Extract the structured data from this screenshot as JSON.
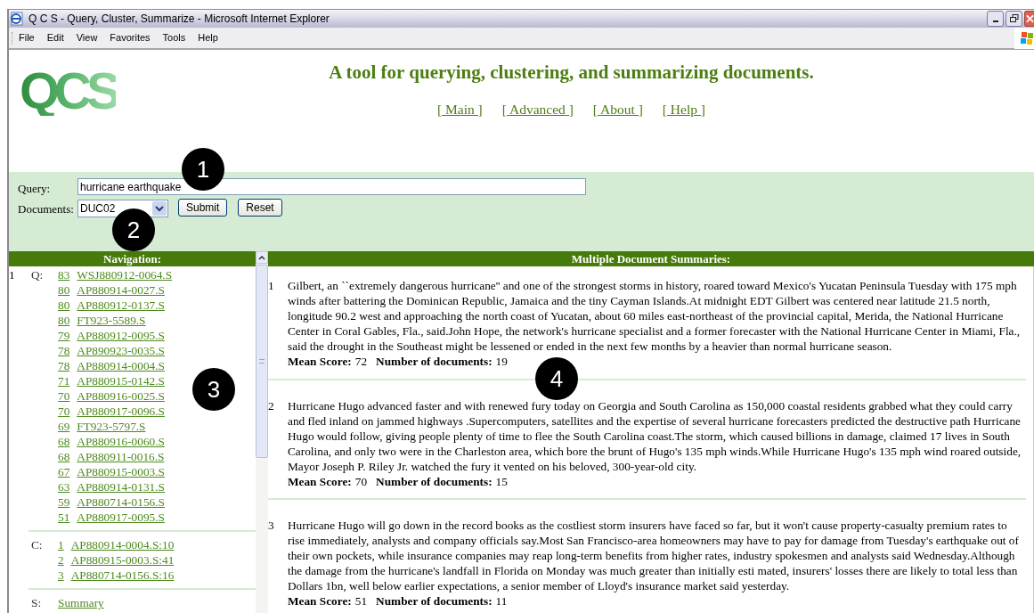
{
  "window": {
    "title": "Q C S - Query, Cluster, Summarize - Microsoft Internet Explorer"
  },
  "menu": [
    {
      "label": "File"
    },
    {
      "label": "Edit"
    },
    {
      "label": "View"
    },
    {
      "label": "Favorites"
    },
    {
      "label": "Tools"
    },
    {
      "label": "Help"
    }
  ],
  "header": {
    "logo": "QCS",
    "heading": "A tool for querying, clustering, and summarizing documents.",
    "nav_links": [
      "[ Main ]",
      "[ Advanced ]",
      "[ About ]",
      "[ Help ]"
    ]
  },
  "form": {
    "query_label": "Query:",
    "query_value": "hurricane earthquake",
    "documents_label": "Documents:",
    "documents_value": "DUC02",
    "buttons": [
      "Submit",
      "Reset"
    ]
  },
  "navigation": {
    "title": "Navigation:",
    "number": "1",
    "groups": [
      {
        "label": "Q:",
        "links": [
          {
            "score": "83",
            "doc": "WSJ880912-0064.S"
          },
          {
            "score": "80",
            "doc": "AP880914-0027.S"
          },
          {
            "score": "80",
            "doc": "AP880912-0137.S"
          },
          {
            "score": "80",
            "doc": "FT923-5589.S"
          },
          {
            "score": "79",
            "doc": "AP880912-0095.S"
          },
          {
            "score": "78",
            "doc": "AP890923-0035.S"
          },
          {
            "score": "78",
            "doc": "AP880914-0004.S"
          },
          {
            "score": "71",
            "doc": "AP880915-0142.S"
          },
          {
            "score": "70",
            "doc": "AP880916-0025.S"
          },
          {
            "score": "70",
            "doc": "AP880917-0096.S"
          },
          {
            "score": "69",
            "doc": "FT923-5797.S"
          },
          {
            "score": "68",
            "doc": "AP880916-0060.S"
          },
          {
            "score": "68",
            "doc": "AP880911-0016.S"
          },
          {
            "score": "67",
            "doc": "AP880915-0003.S"
          },
          {
            "score": "63",
            "doc": "AP880914-0131.S"
          },
          {
            "score": "59",
            "doc": "AP880714-0156.S"
          },
          {
            "score": "51",
            "doc": "AP880917-0095.S"
          }
        ]
      },
      {
        "label": "C:",
        "links": [
          {
            "score": "1",
            "doc": "AP880914-0004.S:10"
          },
          {
            "score": "2",
            "doc": "AP880915-0003.S:41"
          },
          {
            "score": "3",
            "doc": "AP880714-0156.S:16"
          }
        ]
      },
      {
        "label": "S:",
        "links": [
          {
            "doc": "Summary"
          }
        ]
      }
    ]
  },
  "summaries": {
    "title": "Multiple Document Summaries:",
    "items": [
      {
        "number": "1",
        "text": "Gilbert, an ``extremely dangerous hurricane'' and one of the strongest storms in history, roared toward Mexico's Yucatan Peninsula Tuesday with 175 mph winds after battering the Dominican Republic, Jamaica and the tiny Cayman Islands.At midnight EDT Gilbert was centered near latitude 21.5 north, longitude 90.2 west and approaching the north coast of Yucatan, about 60 miles east-northeast of the provincial capital, Merida, the National Hurricane Center in Coral Gables, Fla., said.John Hope, the network's hurricane specialist and a former forecaster with the National Hurricane Center in Miami, Fla., said the drought in the Southeast might be lessened or ended in the next few months by a heavier than normal hurricane season.",
        "score_label": "Mean Score:",
        "score": "72",
        "count_label": "Number of documents:",
        "count": "19"
      },
      {
        "number": "2",
        "text": "Hurricane Hugo advanced faster and with renewed fury today on Georgia and South Carolina as 150,000 coastal residents grabbed what they could carry and fled inland on jammed highways .Supercomputers, satellites and the expertise of several hurricane forecasters predicted the destructive path Hurricane Hugo would follow, giving people plenty of time to flee the South Carolina coast.The storm, which caused billions in damage, claimed 17 lives in South Carolina, and only two were in the Charleston area, which bore the brunt of Hugo's 135 mph winds.While Hurricane Hugo's 135 mph wind roared outside, Mayor Joseph P. Riley Jr. watched the fury it vented on his beloved, 300-year-old city.",
        "score_label": "Mean Score:",
        "score": "70",
        "count_label": "Number of documents:",
        "count": "15"
      },
      {
        "number": "3",
        "text": "Hurricane Hugo will go down in the record books as the costliest storm insurers have faced so far, but it won't cause property-casualty premium rates to rise immediately, analysts and company officials say.Most San Francisco-area homeowners may have to pay for damage from Tuesday's earthquake out of their own pockets, while insurance companies may reap long-term benefits from higher rates, industry spokesmen and analysts said Wednesday.Although the damage from the hurricane's landfall in Florida on Monday was much greater than initially esti mated, insurers' losses there are likely to total less than Dollars 1bn, well below earlier expectations, a senior member of Lloyd's insurance market said yesterday.",
        "score_label": "Mean Score:",
        "score": "51",
        "count_label": "Number of documents:",
        "count": "11"
      }
    ]
  },
  "callouts": [
    "1",
    "2",
    "3",
    "4"
  ]
}
